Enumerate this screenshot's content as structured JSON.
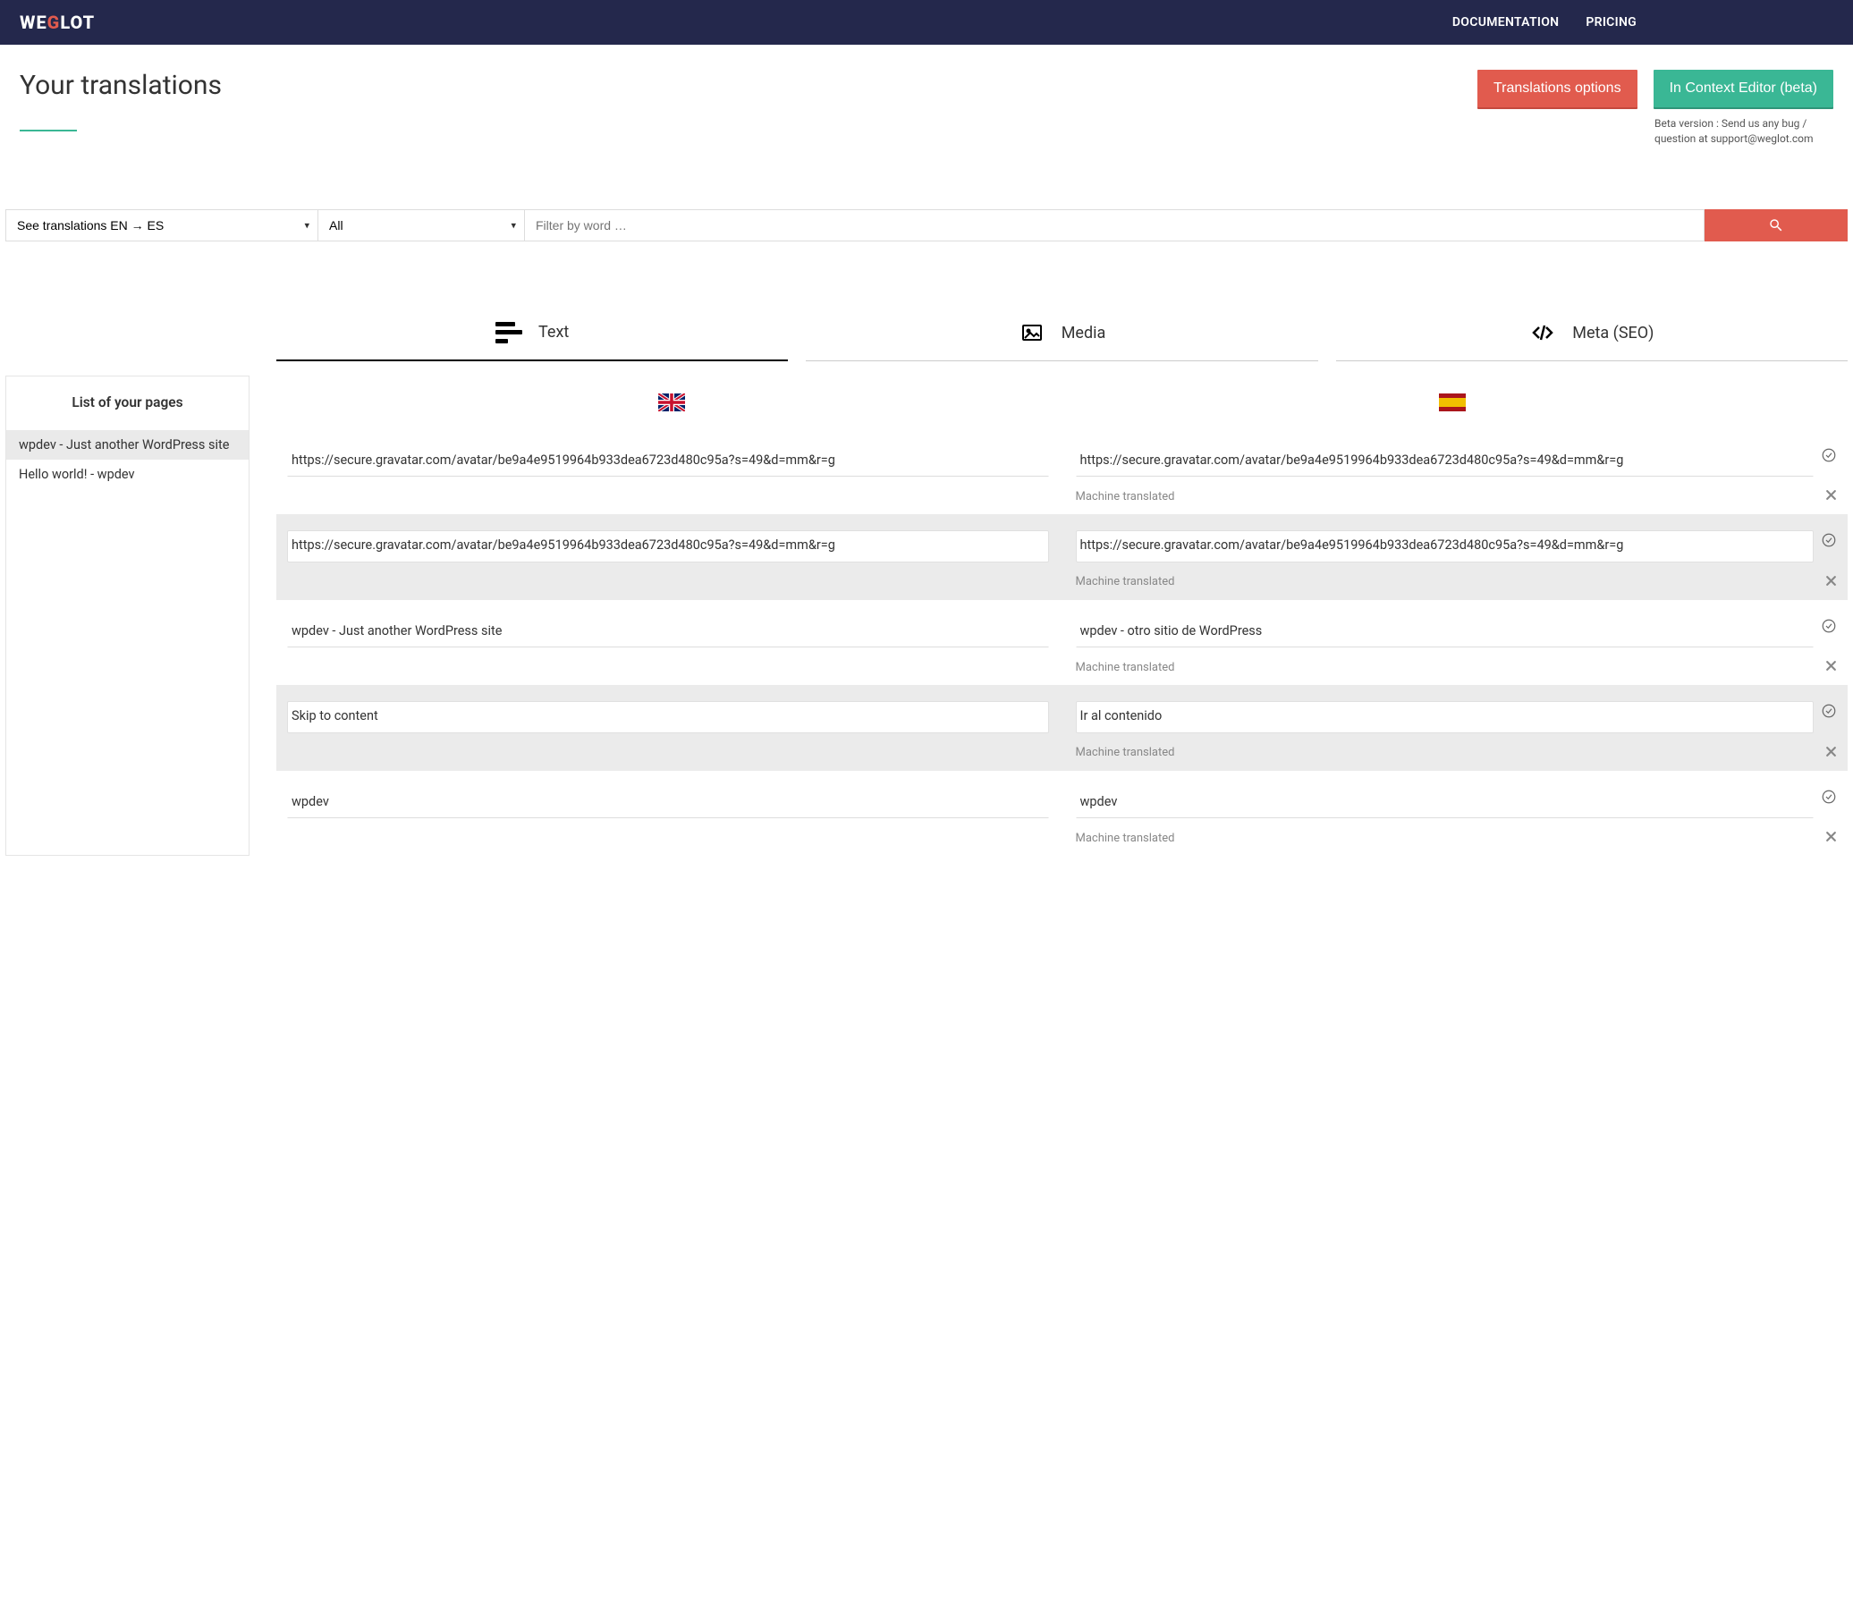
{
  "brand": {
    "pre": "WE",
    "mid": "G",
    "post": "LOT"
  },
  "nav": {
    "documentation": "DOCUMENTATION",
    "pricing": "PRICING"
  },
  "page": {
    "title": "Your translations",
    "btn_options": "Translations options",
    "btn_editor": "In Context Editor (beta)",
    "beta_note": "Beta version : Send us any bug / question at support@weglot.com"
  },
  "filters": {
    "lang_select": "See translations EN → ES",
    "type_select": "All",
    "search_placeholder": "Filter by word …"
  },
  "tabs": {
    "text": "Text",
    "media": "Media",
    "meta": "Meta (SEO)"
  },
  "sidebar": {
    "title": "List of your pages",
    "items": [
      "wpdev - Just another WordPress site",
      "Hello world! - wpdev"
    ]
  },
  "status": {
    "machine": "Machine translated"
  },
  "rows": [
    {
      "src": "https://secure.gravatar.com/avatar/be9a4e9519964b933dea6723d480c95a?s=49&d=mm&r=g",
      "tgt": "https://secure.gravatar.com/avatar/be9a4e9519964b933dea6723d480c95a?s=49&d=mm&r=g"
    },
    {
      "src": "https://secure.gravatar.com/avatar/be9a4e9519964b933dea6723d480c95a?s=49&d=mm&r=g",
      "tgt": "https://secure.gravatar.com/avatar/be9a4e9519964b933dea6723d480c95a?s=49&d=mm&r=g"
    },
    {
      "src": "wpdev - Just another WordPress site",
      "tgt": "wpdev - otro sitio de WordPress"
    },
    {
      "src": "Skip to content",
      "tgt": "Ir al contenido"
    },
    {
      "src": "wpdev",
      "tgt": "wpdev"
    }
  ]
}
